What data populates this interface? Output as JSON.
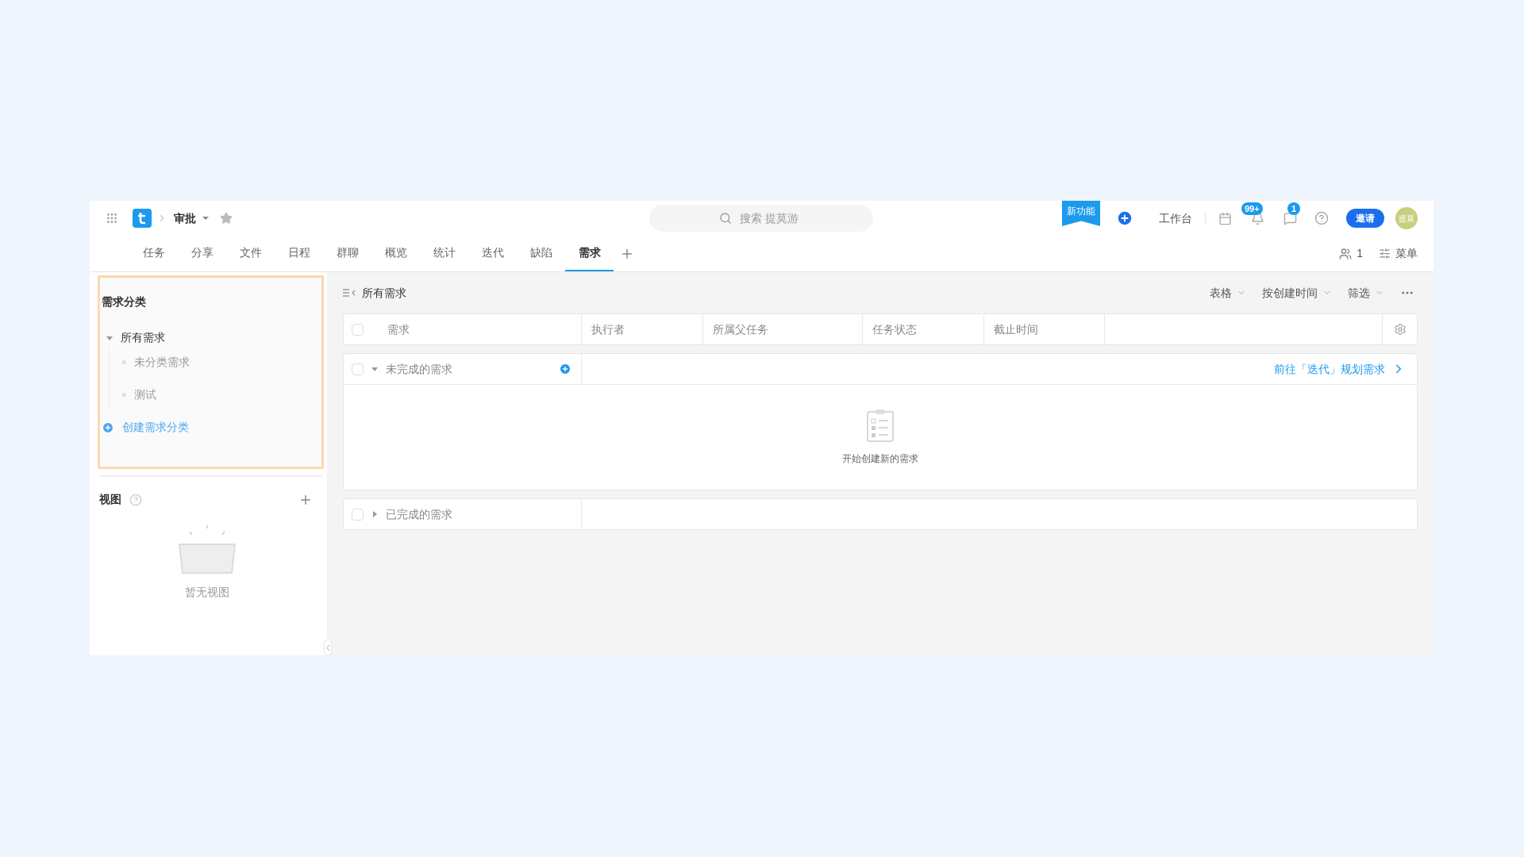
{
  "header": {
    "breadcrumb": "审批",
    "search": {
      "placeholder": "搜索 提莫游"
    },
    "new_feature": "新功能",
    "workbench": "工作台",
    "notification_badge": "99+",
    "message_badge": "1",
    "invite": "邀请",
    "avatar": "提莫"
  },
  "tabs": [
    {
      "label": "任务",
      "selected": false
    },
    {
      "label": "分享",
      "selected": false
    },
    {
      "label": "文件",
      "selected": false
    },
    {
      "label": "日程",
      "selected": false
    },
    {
      "label": "群聊",
      "selected": false
    },
    {
      "label": "概览",
      "selected": false
    },
    {
      "label": "统计",
      "selected": false
    },
    {
      "label": "迭代",
      "selected": false
    },
    {
      "label": "缺陷",
      "selected": false
    },
    {
      "label": "需求",
      "selected": true
    }
  ],
  "tab_bar_right": {
    "members": "1",
    "menu": "菜单"
  },
  "sidebar": {
    "title": "需求分类",
    "tree": [
      {
        "label": "所有需求",
        "expanded": true,
        "children": [
          {
            "label": "未分类需求"
          },
          {
            "label": "测试"
          }
        ]
      }
    ],
    "create": "创建需求分类",
    "views_title": "视图",
    "views_empty": "暂无视图"
  },
  "main": {
    "title": "所有需求",
    "toolbar": [
      "表格",
      "按创建时间",
      "筛选"
    ],
    "table": {
      "select_all_checked": false,
      "columns": [
        "需求",
        "执行者",
        "所属父任务",
        "任务状态",
        "截止时间"
      ],
      "groups": [
        {
          "label": "未完成的需求",
          "expanded": true,
          "checked": false,
          "link": "前往「迭代」规划需求",
          "empty": "开始创建新的需求"
        },
        {
          "label": "已完成的需求",
          "expanded": false,
          "checked": false
        }
      ]
    }
  }
}
